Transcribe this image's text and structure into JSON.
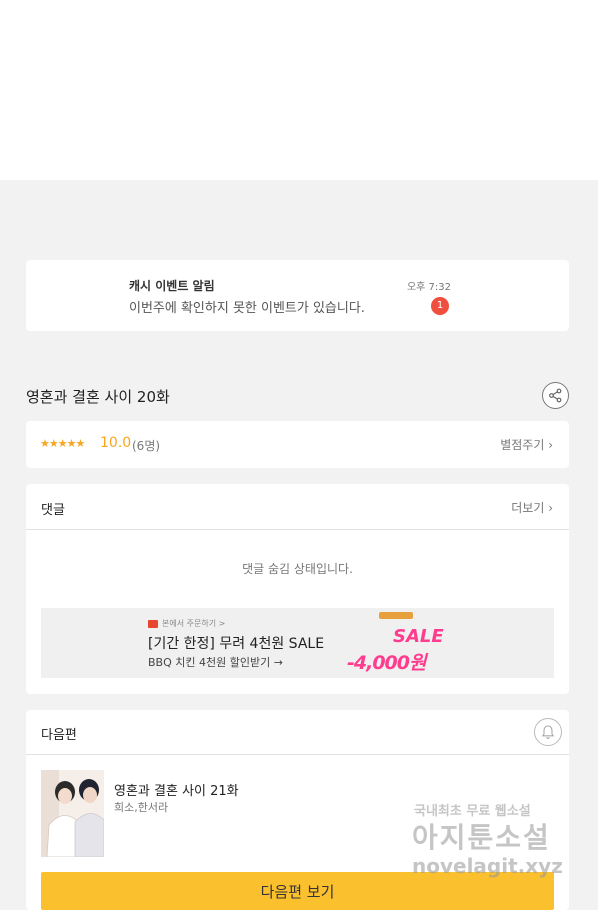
{
  "notification": {
    "title": "캐시 이벤트 알림",
    "message": "이번주에 확인하지 못한 이벤트가 있습니다.",
    "time": "오후 7:32",
    "badge": "1"
  },
  "episode": {
    "title": "영혼과 결혼 사이 20화",
    "share_icon": "share-icon"
  },
  "rating": {
    "stars": "★★★★★",
    "score": "10.0",
    "count": "(6명)",
    "rate_label": "별점주기 ›"
  },
  "comments": {
    "title": "댓글",
    "more_label": "더보기 ›",
    "hidden_message": "댓글 숨김 상태입니다."
  },
  "ad": {
    "source": "본에서 주문하기 >",
    "headline": "[기간 한정] 무려 4천원 SALE",
    "subline": "BBQ 치킨 4천원 할인받기 →",
    "sale_text": "SALE",
    "discount_text": "-4,000원"
  },
  "next_episode": {
    "section_title": "다음편",
    "bell_icon": "bell-icon",
    "title": "영혼과 결혼 사이 21화",
    "authors": "희소,한서라",
    "button_label": "다음편 보기"
  },
  "watermark": {
    "line1": "국내최초 무료 웹소설",
    "line2": "아지툰소설",
    "line3": "novelagit.xyz"
  },
  "colors": {
    "accent": "#f5a623",
    "badge": "#f04e3e",
    "button": "#fbc02d",
    "sale": "#ff3c8e"
  }
}
